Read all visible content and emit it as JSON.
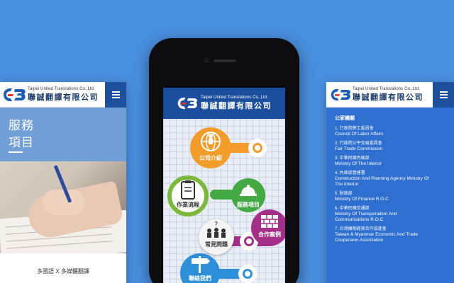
{
  "logo": {
    "en": "Taipei United Translations Co.,Ltd.",
    "zh": "聯誠翻譯有限公司"
  },
  "left": {
    "hero_title": "服務\n項目",
    "caption": "多國語 X 多媒體翻譯"
  },
  "center": {
    "items": [
      {
        "label": "公司介紹",
        "color": "#f39c2a",
        "icon": "globe-people-icon"
      },
      {
        "label": "服務項目",
        "color": "#43a943",
        "icon": "hand-cloche-icon"
      },
      {
        "label": "作業流程",
        "color": "#7cb93a",
        "icon": "clipboard-hand-icon"
      },
      {
        "label": "常見問題",
        "color": "#f4f4f4",
        "icon": "people-question-icon"
      },
      {
        "label": "合作案例",
        "color": "#a52f88",
        "icon": "brick-wall-icon"
      },
      {
        "label": "聯絡我們",
        "color": "#2c8fd8",
        "icon": "signpost-icon"
      }
    ]
  },
  "right": {
    "section": "公家機關",
    "orgs": [
      {
        "zh": "1. 行政院勞工委員會",
        "en": "Council Of Labor Affairs"
      },
      {
        "zh": "2. 行政院公平交易委員會",
        "en": "Fair Trade Commission"
      },
      {
        "zh": "3. 中華民國內政部",
        "en": "Ministry Of The Interior"
      },
      {
        "zh": "4. 內政部營建署",
        "en": "Construction And Planning Agency Ministry Of",
        "en2": "The Interior"
      },
      {
        "zh": "5. 財政部",
        "en": "Ministry Of Finance R.O.C"
      },
      {
        "zh": "6. 中華民國交通部",
        "en": "Ministry Of Transportation And",
        "en2": "Communications R.O.C"
      },
      {
        "zh": "7. 台灣緬甸經貿合作協進會",
        "en": "Taiwan & Myanmar Economic And Trade",
        "en2": "Cooperaion Association"
      }
    ]
  }
}
